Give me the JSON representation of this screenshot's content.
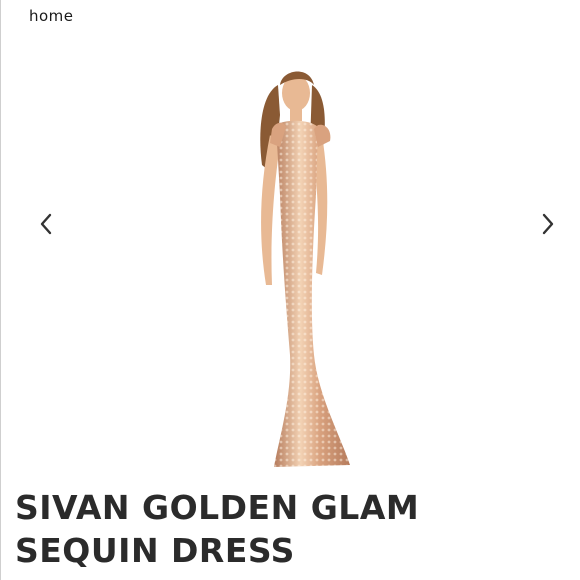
{
  "nav": {
    "home_label": "home"
  },
  "carousel": {
    "prev_icon": "chevron-left-icon",
    "next_icon": "chevron-right-icon",
    "image_subject": "model in rose-gold sequin gown"
  },
  "product": {
    "title_line1": "SIVAN GOLDEN GLAM",
    "title_line2": "SEQUIN DRESS"
  },
  "colors": {
    "dress": "#d9a27f",
    "dress_highlight": "#f3d2b4",
    "dress_shadow": "#b57b5c",
    "hair": "#8a5a34",
    "skin": "#e8b994",
    "title": "#2b2b2b",
    "arrow": "#333333"
  }
}
